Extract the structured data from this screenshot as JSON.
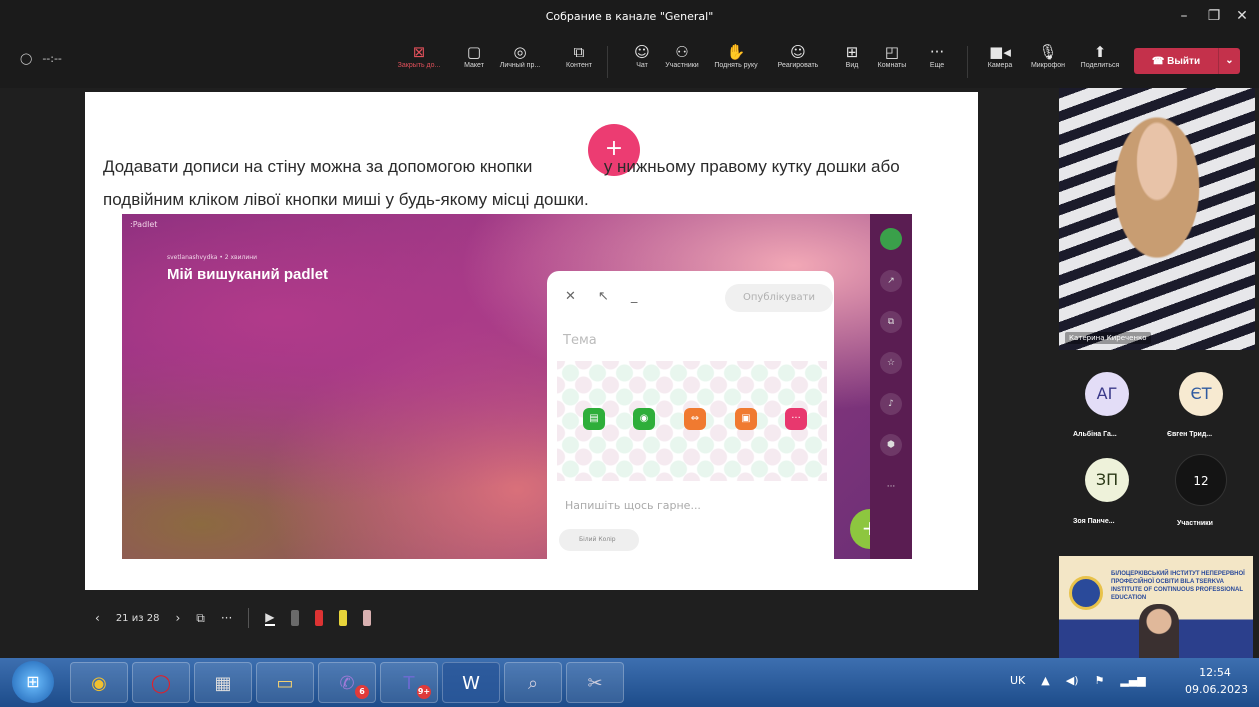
{
  "window": {
    "title": "Собрание в канале \"General\"",
    "minimize": "–",
    "restore": "❐",
    "close": "✕"
  },
  "meeting": {
    "timer": "--:--"
  },
  "toolbar": {
    "buttons": [
      {
        "label": "Закрыть до...",
        "icon": "⊠"
      },
      {
        "label": "Макет",
        "icon": "▢"
      },
      {
        "label": "Личный пр...",
        "icon": "◎"
      },
      {
        "label": "Контент",
        "icon": "⧉"
      },
      {
        "label": "Чат",
        "icon": "☺"
      },
      {
        "label": "Участники",
        "icon": "⚇"
      },
      {
        "label": "Поднять руку",
        "icon": "✋"
      },
      {
        "label": "Реагировать",
        "icon": "☺"
      },
      {
        "label": "Вид",
        "icon": "⊞"
      },
      {
        "label": "Комнаты",
        "icon": "◰"
      },
      {
        "label": "Еще",
        "icon": "···"
      },
      {
        "label": "Камера",
        "icon": "■◂"
      },
      {
        "label": "Микрофон",
        "icon": "🎙"
      },
      {
        "label": "Поделиться",
        "icon": "⬆"
      }
    ],
    "leave_label": "Выйти",
    "leave_icon": "☎"
  },
  "slide": {
    "text_part1": "Додавати дописи на стіну можна за допомогою кнопки",
    "text_part2": "у нижньому правому кутку дошки або подвійним кліком лівої кнопки миші у будь-якому місці дошки.",
    "plus_symbol": "+",
    "padlet": {
      "brand": ":Padlet",
      "meta": "svetlanashvydka • 2 хвилини",
      "title": "Мій вишуканий padlet",
      "publish": "Опублікувати",
      "topic_placeholder": "Тема",
      "write_placeholder": "Напишіть щось гарне...",
      "color_chip": "Білий Колір",
      "fab": "+"
    }
  },
  "slide_controls": {
    "counter": "21 из 28",
    "prev": "‹",
    "next": "›"
  },
  "participants": {
    "main_video_name": "Катерина Киреченко",
    "tiles": [
      {
        "initials": "АГ",
        "name": "Альбіна Га...",
        "bg": "#e3ddf7",
        "fg": "#3b3a8a"
      },
      {
        "initials": "ЄТ",
        "name": "Євген Трид...",
        "bg": "#f7ead1",
        "fg": "#2f5aa0"
      },
      {
        "initials": "ЗП",
        "name": "Зоя Панче...",
        "bg": "#eef2da",
        "fg": "#2c3a18"
      },
      {
        "initials": "12",
        "name": "Участники",
        "bg": "#141414",
        "fg": "#ffffff"
      }
    ],
    "institute_text": "БІЛОЦЕРКІВСЬКИЙ ІНСТИТУТ НЕПЕРЕРВНОЇ ПРОФЕСІЙНОЇ ОСВІТИ BILA TSERKVA INSTITUTE OF CONTINUOUS PROFESSIONAL EDUCATION"
  },
  "taskbar": {
    "badges": {
      "viber": "6",
      "teams": "9+"
    },
    "tray": {
      "lang": "UK",
      "up": "▲",
      "volume": "◀)",
      "flag": "⚑",
      "signal": "▂▄▆"
    },
    "time": "12:54",
    "date": "09.06.2023"
  },
  "colors": {
    "leave": "#c4314b",
    "padlet_pink": "#ec3c72",
    "fab_green": "#8dc63f"
  }
}
